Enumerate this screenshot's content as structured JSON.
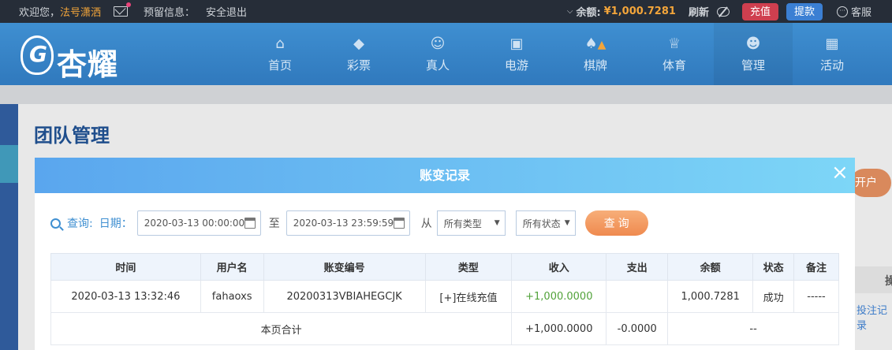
{
  "topbar": {
    "welcome": "欢迎您，",
    "username": "法号潇洒",
    "reserve_info": "预留信息：",
    "logout": "安全退出",
    "balance_label": "余额:",
    "balance_value": "¥1,000.7281",
    "refresh": "刷新",
    "charge": "充值",
    "withdraw": "提款",
    "service": "客服"
  },
  "logo": {
    "text": "杏耀"
  },
  "nav": {
    "items": [
      {
        "label": "首页",
        "icon": "home-icon"
      },
      {
        "label": "彩票",
        "icon": "ticket-icon"
      },
      {
        "label": "真人",
        "icon": "person-icon"
      },
      {
        "label": "电游",
        "icon": "arcade-icon"
      },
      {
        "label": "棋牌",
        "icon": "cards-icon"
      },
      {
        "label": "体育",
        "icon": "trophy-icon"
      },
      {
        "label": "管理",
        "icon": "users-icon"
      },
      {
        "label": "活动",
        "icon": "gift-icon"
      }
    ]
  },
  "page": {
    "title": "团队管理",
    "side_button": "开户",
    "side_text": "投注记录",
    "side_header": "操"
  },
  "modal": {
    "title": "账变记录",
    "close": "×",
    "filter": {
      "query_label": "查询:",
      "date_label": "日期：",
      "start_date": "2020-03-13 00:00:00",
      "to": "至",
      "end_date": "2020-03-13 23:59:59",
      "from": "从",
      "type_select": "所有类型",
      "status_select": "所有状态",
      "query_button": "查 询"
    },
    "table": {
      "headers": [
        "时间",
        "用户名",
        "账变编号",
        "类型",
        "收入",
        "支出",
        "余额",
        "状态",
        "备注"
      ],
      "rows": [
        [
          "2020-03-13 13:32:46",
          "fahaoxs",
          "20200313VBIAHEGCJK",
          "[+]在线充值",
          "+1,000.0000",
          "",
          "1,000.7281",
          "成功",
          "-----"
        ]
      ],
      "summary": {
        "label": "本页合计",
        "income": "+1,000.0000",
        "expense": "-0.0000",
        "rest": "--"
      }
    }
  },
  "colors": {
    "topbar_bg": "#262d38",
    "accent_orange": "#f3a53a",
    "nav_blue": "#3f8fd1",
    "income_green": "#52a23a"
  }
}
